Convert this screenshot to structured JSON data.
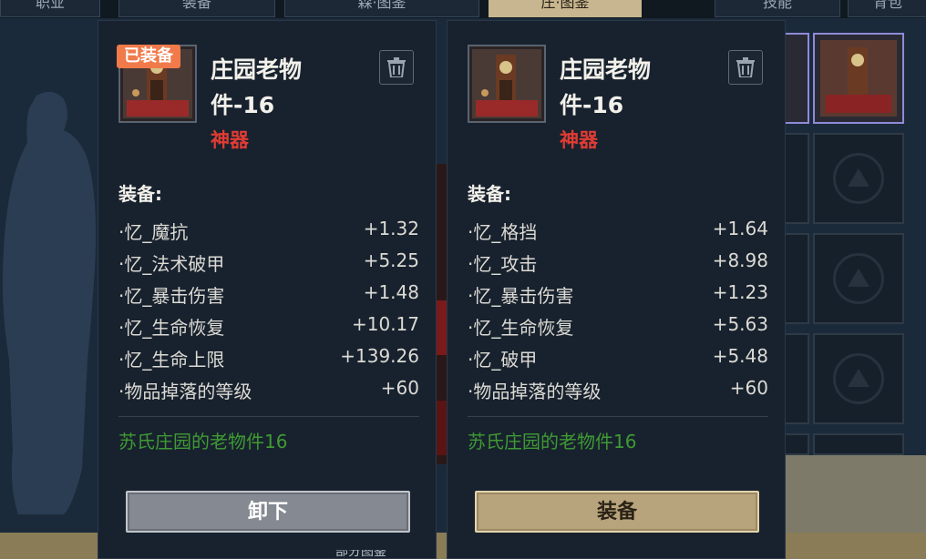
{
  "top_tabs": [
    {
      "label": "职业",
      "active": false
    },
    {
      "label": "装备",
      "active": false
    },
    {
      "label": "森·图鉴",
      "active": false
    },
    {
      "label": "庄·图鉴",
      "active": true
    },
    {
      "label": "技能",
      "active": false
    },
    {
      "label": "背包",
      "active": false
    }
  ],
  "colors": {
    "panel_bg": "#18222e",
    "rarity": "#e03c34",
    "flavor": "#3f9a33",
    "badge": "#f07a4a",
    "equip_button": "#b8a47c",
    "unequip_button": "#858a92"
  },
  "equipped_item": {
    "badge": "已装备",
    "name": "庄园老物件-16",
    "rarity": "神器",
    "section_label": "装备:",
    "stats": [
      {
        "name": "·忆_魔抗",
        "value": "+1.32"
      },
      {
        "name": "·忆_法术破甲",
        "value": "+5.25"
      },
      {
        "name": "·忆_暴击伤害",
        "value": "+1.48"
      },
      {
        "name": "·忆_生命恢复",
        "value": "+10.17"
      },
      {
        "name": "·忆_生命上限",
        "value": "+139.26"
      },
      {
        "name": "·物品掉落的等级",
        "value": "+60"
      }
    ],
    "flavor": "苏氏庄园的老物件16",
    "action_label": "卸下",
    "icon": "trash-icon"
  },
  "compare_item": {
    "name": "庄园老物件-16",
    "rarity": "神器",
    "section_label": "装备:",
    "stats": [
      {
        "name": "·忆_格挡",
        "value": "+1.64"
      },
      {
        "name": "·忆_攻击",
        "value": "+8.98"
      },
      {
        "name": "·忆_暴击伤害",
        "value": "+1.23"
      },
      {
        "name": "·忆_生命恢复",
        "value": "+5.63"
      },
      {
        "name": "·忆_破甲",
        "value": "+5.48"
      },
      {
        "name": "·物品掉落的等级",
        "value": "+60"
      }
    ],
    "flavor": "苏氏庄园的老物件16",
    "action_label": "装备",
    "icon": "trash-icon"
  },
  "bottom_text": "部分图鉴"
}
